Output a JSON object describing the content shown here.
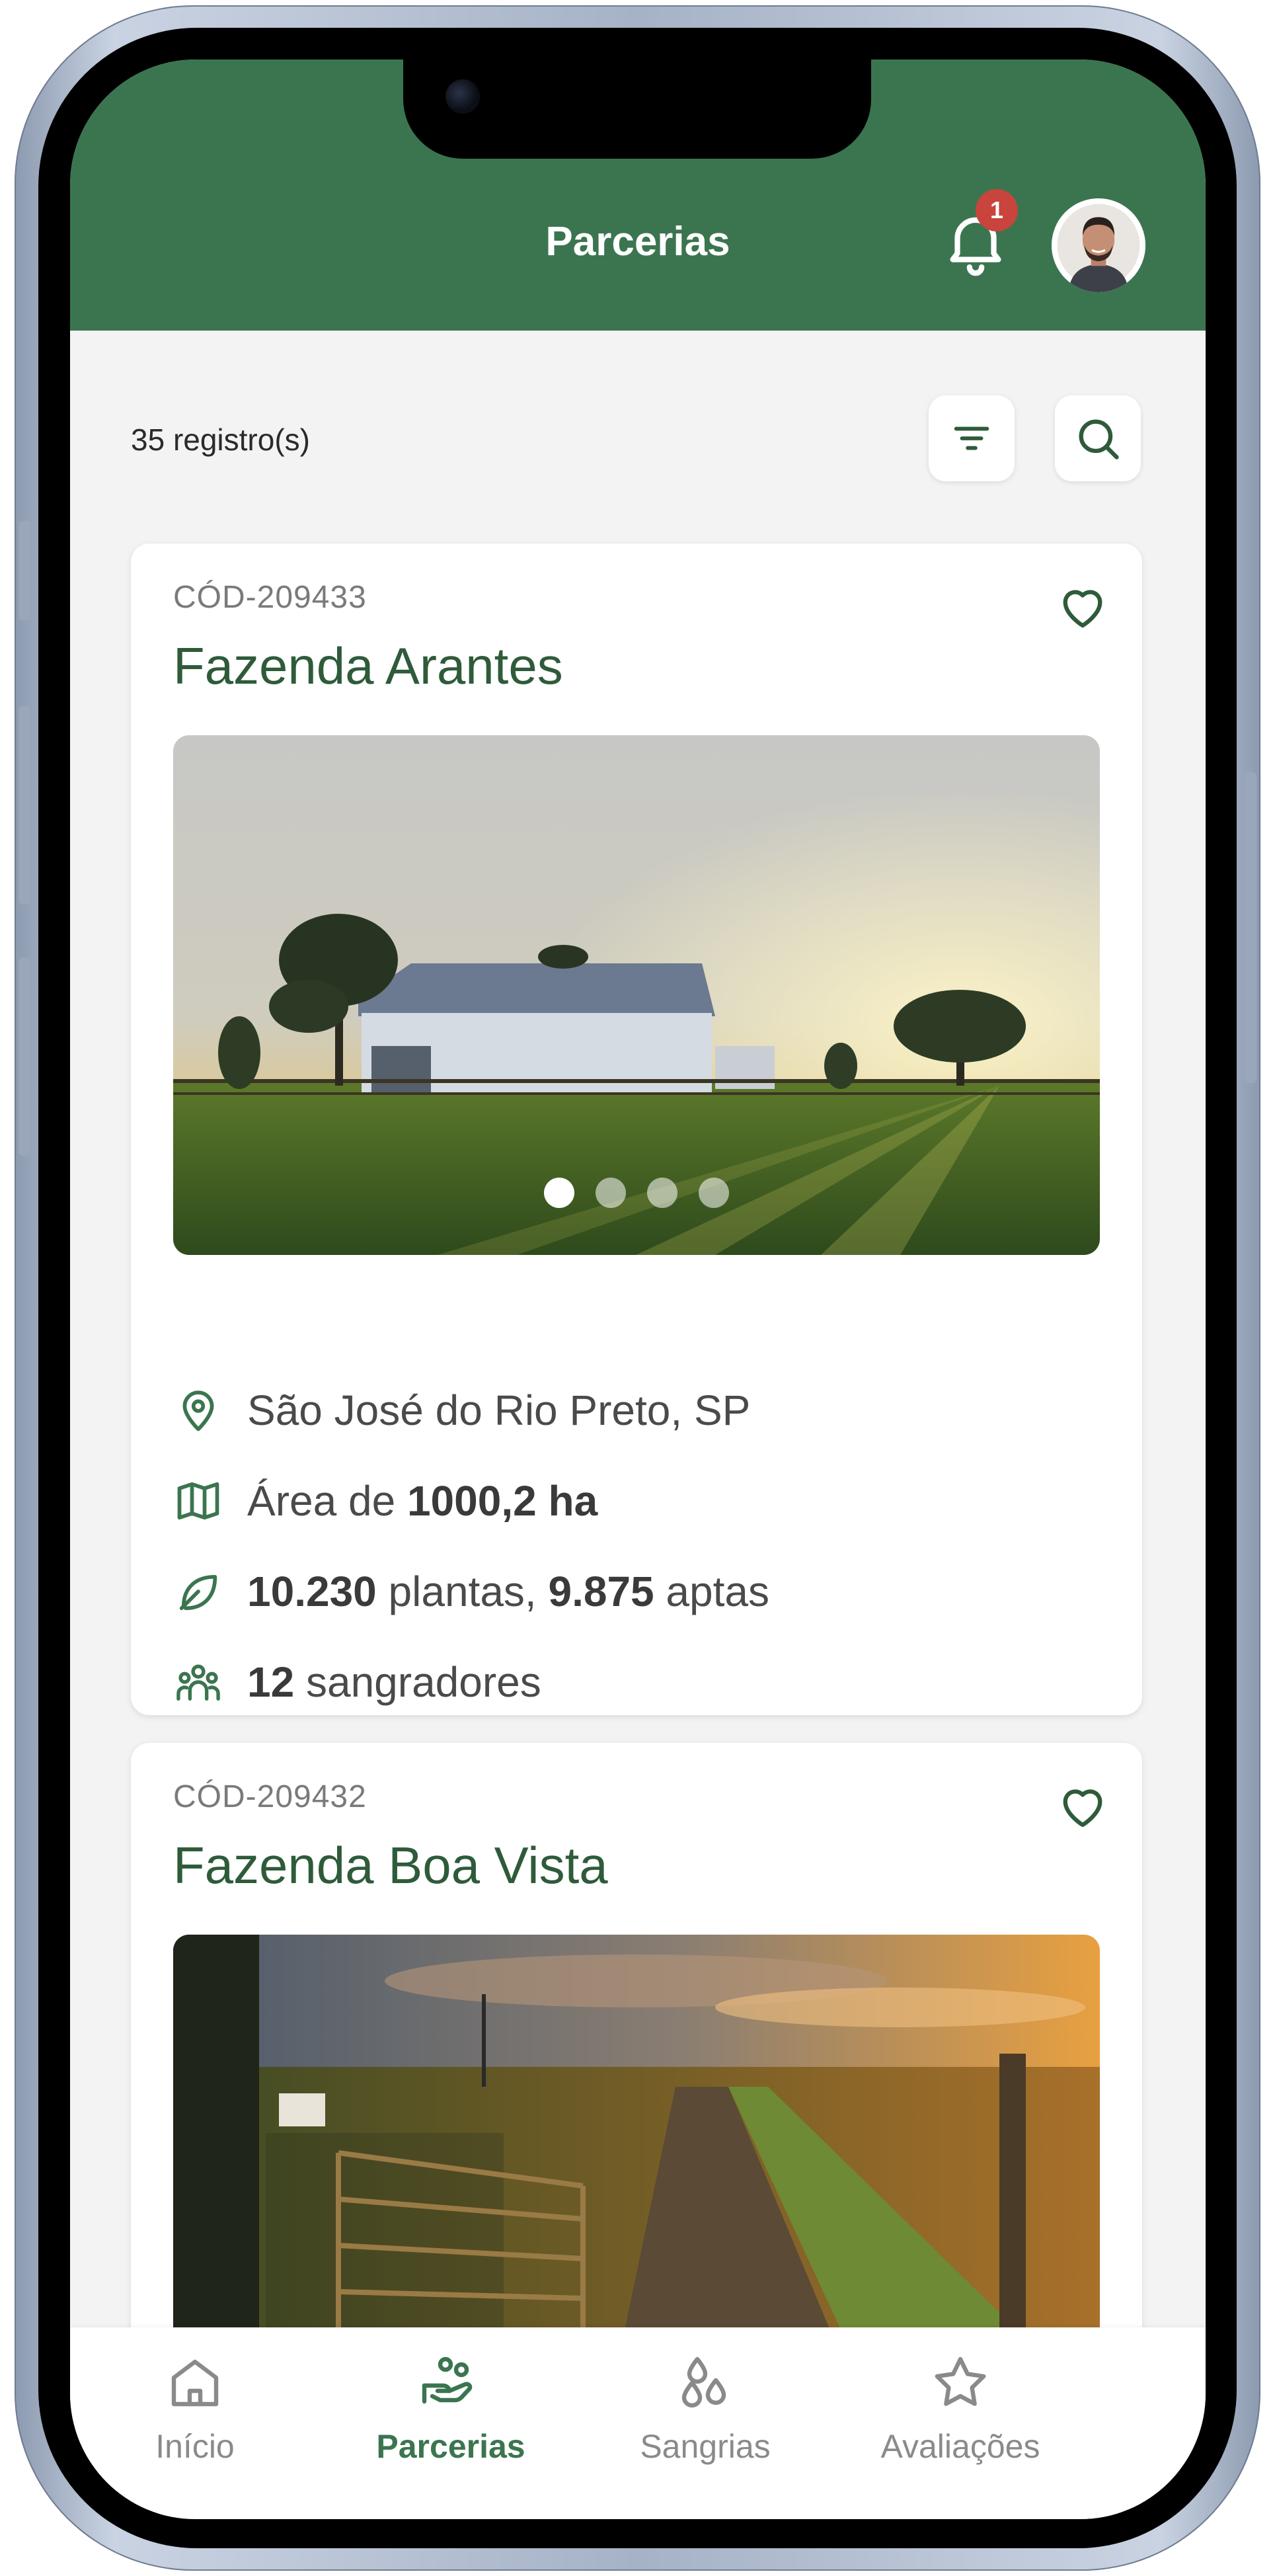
{
  "header": {
    "title": "Parcerias",
    "notification_count": "1"
  },
  "toolbar": {
    "record_count": "35 registro(s)"
  },
  "cards": [
    {
      "code": "CÓD-209433",
      "title": "Fazenda Arantes",
      "location": "São José do Rio Preto, SP",
      "area_prefix": "Área de ",
      "area_value": "1000,2 ha",
      "plants_value": "10.230",
      "plants_mid": " plantas, ",
      "apt_value": "9.875",
      "apt_suffix": " aptas",
      "tappers_value": "12",
      "tappers_suffix": " sangradores",
      "photo": "barn-at-sunset",
      "carousel_total": 4,
      "carousel_active": 1
    },
    {
      "code": "CÓD-209432",
      "title": "Fazenda Boa Vista",
      "photo": "farm-road-with-gate"
    }
  ],
  "nav": [
    {
      "label": "Início",
      "icon": "home-icon"
    },
    {
      "label": "Parcerias",
      "icon": "partnership-icon",
      "active": true
    },
    {
      "label": "Sangrias",
      "icon": "drops-icon"
    },
    {
      "label": "Avaliações",
      "icon": "star-icon"
    }
  ],
  "colors": {
    "brand_green": "#3b7550",
    "title_green": "#2e5b3a",
    "badge_red": "#c8443c",
    "background": "#f3f3f3"
  }
}
